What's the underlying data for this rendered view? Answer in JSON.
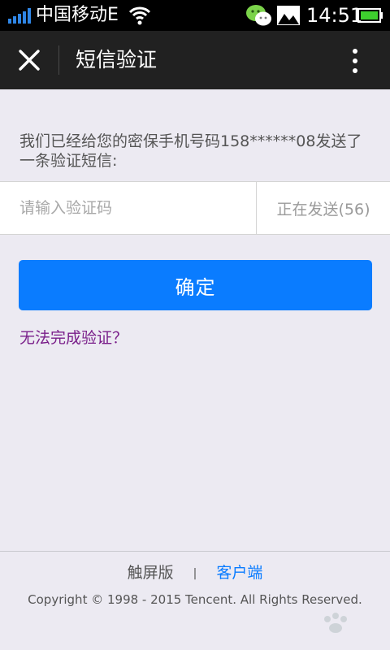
{
  "status_bar": {
    "carrier": "中国移动E",
    "time": "14:51",
    "icons": [
      "signal-icon",
      "wifi-icon",
      "wechat-icon",
      "gallery-icon",
      "battery-icon"
    ]
  },
  "header": {
    "title": "短信验证",
    "close_icon": "close-icon",
    "more_icon": "more-icon"
  },
  "notice": {
    "text": "我们已经给您的密保手机号码158******08发送了一条验证短信:"
  },
  "form": {
    "code_placeholder": "请输入验证码",
    "code_value": "",
    "resend_label": "正在发送(56)",
    "confirm_label": "确定",
    "help_link": "无法完成验证？"
  },
  "footer": {
    "touch_label": "触屏版",
    "separator": "|",
    "client_label": "客户端",
    "copyright": "Copyright © 1998 - 2015 Tencent. All Rights Reserved."
  },
  "colors": {
    "background": "#eceaf2",
    "title_bar": "#212121",
    "accent": "#0a7cff",
    "help_link": "#7a1f8a"
  }
}
